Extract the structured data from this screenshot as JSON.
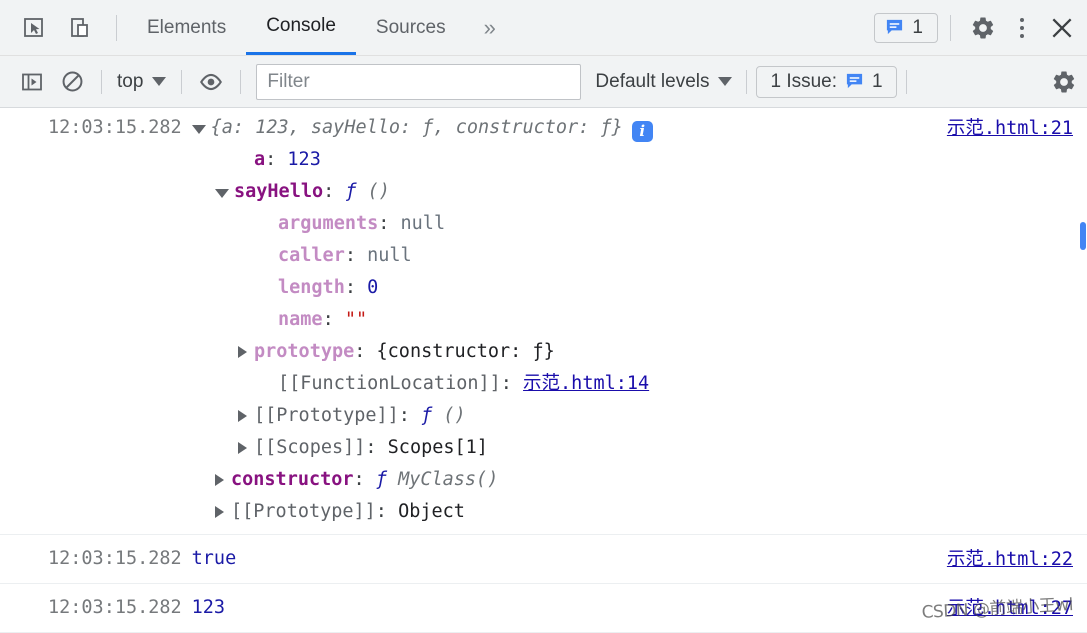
{
  "devtools": {
    "tabs": [
      {
        "label": "Elements",
        "active": false
      },
      {
        "label": "Console",
        "active": true
      },
      {
        "label": "Sources",
        "active": false
      }
    ],
    "overflow_label": "»",
    "message_count": "1",
    "icons": {
      "inspect": "inspect-element-icon",
      "device": "device-toolbar-icon",
      "chat": "chat-message-icon",
      "gear": "settings-gear-icon",
      "kebab": "more-options-icon",
      "close": "close-icon"
    }
  },
  "console_toolbar": {
    "sidebar_toggle": "console-sidebar-icon",
    "clear_label": "clear-console-icon",
    "context": "top",
    "eye_label": "live-expression-icon",
    "filter_placeholder": "Filter",
    "filter_value": "",
    "levels_label": "Default levels",
    "issues_label": "1 Issue:",
    "issues_count": "1",
    "settings_label": "console-settings-icon"
  },
  "console_entries": [
    {
      "timestamp": "12:03:15.282",
      "source": "示范.html:21",
      "preview": {
        "open": "{",
        "parts": "a: 123, sayHello: ƒ, constructor: ƒ",
        "close": "}"
      },
      "badge": "i"
    },
    {
      "timestamp": "12:03:15.282",
      "value": "true",
      "source": "示范.html:22"
    },
    {
      "timestamp": "12:03:15.282",
      "value": "123",
      "source": "示范.html:27"
    }
  ],
  "object_tree": {
    "a": {
      "key": "a",
      "value": "123"
    },
    "sayHello": {
      "key": "sayHello",
      "value_fn": "ƒ",
      "value_sig": "()",
      "children": [
        {
          "key": "arguments",
          "value": "null",
          "kind": "null"
        },
        {
          "key": "caller",
          "value": "null",
          "kind": "null"
        },
        {
          "key": "length",
          "value": "0",
          "kind": "number"
        },
        {
          "key": "name",
          "value": "\"\"",
          "kind": "string"
        },
        {
          "key": "prototype",
          "value": "{constructor: ƒ}",
          "kind": "preview",
          "expandable": true
        },
        {
          "key": "[[FunctionLocation]]",
          "value": "示范.html:14",
          "kind": "link"
        },
        {
          "key": "[[Prototype]]",
          "value_fn": "ƒ",
          "value_sig": "()",
          "kind": "fn",
          "expandable": true
        },
        {
          "key": "[[Scopes]]",
          "value": "Scopes[1]",
          "kind": "plain",
          "expandable": true
        }
      ]
    },
    "constructor": {
      "key": "constructor",
      "value_fn": "ƒ",
      "value_name": "MyClass()",
      "expandable": true
    },
    "proto": {
      "key": "[[Prototype]]",
      "value": "Object",
      "expandable": true
    }
  },
  "watermark": "CSDN @前端小王wl"
}
